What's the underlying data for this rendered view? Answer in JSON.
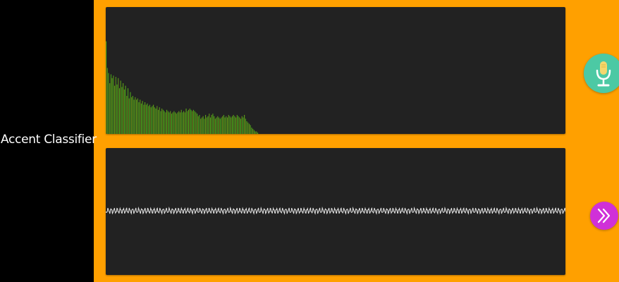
{
  "app": {
    "title": "Accent Classifier"
  },
  "colors": {
    "background": "#FFA000",
    "sidebar": "#000000",
    "panel": "#222222",
    "mic_button": "#4CC9A4",
    "next_button": "#D030D8",
    "waveform_line": "#E8E8E8"
  },
  "icons": {
    "mic_button": "microphone-icon",
    "next_button": "double-chevron-right-icon"
  },
  "spectrum": {
    "description_type": "frequency-bars",
    "levels": [
      0.73,
      0.52,
      0.48,
      0.4,
      0.47,
      0.44,
      0.46,
      0.38,
      0.45,
      0.39,
      0.44,
      0.36,
      0.42,
      0.37,
      0.4,
      0.35,
      0.38,
      0.3,
      0.36,
      0.28,
      0.33,
      0.29,
      0.3,
      0.27,
      0.29,
      0.27,
      0.28,
      0.25,
      0.27,
      0.24,
      0.26,
      0.23,
      0.25,
      0.23,
      0.24,
      0.22,
      0.23,
      0.21,
      0.22,
      0.23,
      0.21,
      0.2,
      0.22,
      0.19,
      0.21,
      0.18,
      0.2,
      0.19,
      0.18,
      0.17,
      0.19,
      0.18,
      0.17,
      0.18,
      0.16,
      0.17,
      0.18,
      0.17,
      0.16,
      0.17,
      0.18,
      0.17,
      0.19,
      0.17,
      0.18,
      0.17,
      0.2,
      0.18,
      0.19,
      0.2,
      0.19,
      0.18,
      0.19,
      0.18,
      0.17,
      0.16,
      0.14,
      0.15,
      0.12,
      0.13,
      0.14,
      0.12,
      0.15,
      0.13,
      0.14,
      0.16,
      0.13,
      0.15,
      0.16,
      0.14,
      0.12,
      0.13,
      0.14,
      0.13,
      0.12,
      0.13,
      0.14,
      0.15,
      0.13,
      0.14,
      0.13,
      0.15,
      0.14,
      0.13,
      0.14,
      0.15,
      0.14,
      0.13,
      0.15,
      0.14,
      0.13,
      0.12,
      0.14,
      0.13,
      0.15,
      0.12,
      0.1,
      0.09,
      0.08,
      0.07,
      0.05,
      0.04,
      0.03,
      0.02,
      0.02,
      0.01
    ],
    "gradient_start": "#D02A1E",
    "gradient_mid": "#9A8A10",
    "gradient_end": "#3CB01A"
  },
  "waveform": {
    "amplitude": 0.025,
    "cycles": 150,
    "line_color": "#E8E8E8"
  }
}
